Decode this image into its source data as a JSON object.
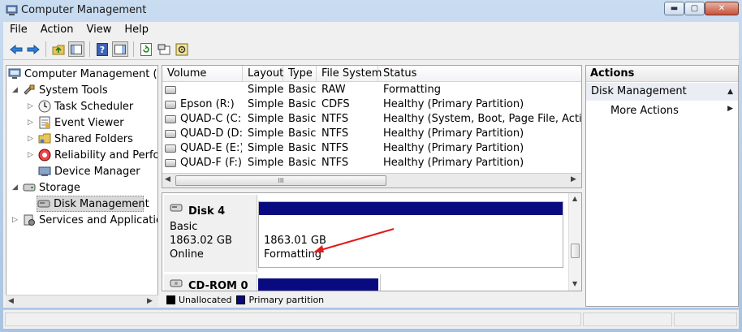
{
  "window": {
    "title": "Computer Management"
  },
  "menu": [
    "File",
    "Action",
    "View",
    "Help"
  ],
  "toolbar": {
    "icons": [
      "back-arrow-icon",
      "forward-arrow-icon",
      "up-folder-icon",
      "show-hide-tree-icon",
      "help-icon",
      "show-hide-action-pane-icon",
      "refresh-icon",
      "properties-icon",
      "settings-icon"
    ]
  },
  "tree": {
    "root": "Computer Management (Local)",
    "system_tools": "System Tools",
    "task_scheduler": "Task Scheduler",
    "event_viewer": "Event Viewer",
    "shared_folders": "Shared Folders",
    "reliability": "Reliability and Performance",
    "device_manager": "Device Manager",
    "storage": "Storage",
    "disk_management": "Disk Management",
    "services": "Services and Applications"
  },
  "volumes": {
    "columns": [
      "Volume",
      "Layout",
      "Type",
      "File System",
      "Status"
    ],
    "rows": [
      {
        "volume": "",
        "layout": "Simple",
        "type": "Basic",
        "fs": "RAW",
        "status": "Formatting"
      },
      {
        "volume": "Epson (R:)",
        "layout": "Simple",
        "type": "Basic",
        "fs": "CDFS",
        "status": "Healthy (Primary Partition)"
      },
      {
        "volume": "QUAD-C (C:)",
        "layout": "Simple",
        "type": "Basic",
        "fs": "NTFS",
        "status": "Healthy (System, Boot, Page File, Active, C"
      },
      {
        "volume": "QUAD-D (D:)",
        "layout": "Simple",
        "type": "Basic",
        "fs": "NTFS",
        "status": "Healthy (Primary Partition)"
      },
      {
        "volume": "QUAD-E (E:)",
        "layout": "Simple",
        "type": "Basic",
        "fs": "NTFS",
        "status": "Healthy (Primary Partition)"
      },
      {
        "volume": "QUAD-F (F:)",
        "layout": "Simple",
        "type": "Basic",
        "fs": "NTFS",
        "status": "Healthy (Primary Partition)"
      }
    ],
    "scroll_thumb": "III"
  },
  "disks": {
    "disk4": {
      "name": "Disk 4",
      "type": "Basic",
      "size": "1863.02 GB",
      "state": "Online",
      "part_size": "1863.01 GB",
      "part_status": "Formatting"
    },
    "cdrom": {
      "name": "CD-ROM 0"
    }
  },
  "legend": {
    "unallocated": "Unallocated",
    "primary": "Primary partition",
    "unallocated_color": "#000000",
    "primary_color": "#0a0a80"
  },
  "actions": {
    "header": "Actions",
    "section": "Disk Management",
    "more": "More Actions"
  },
  "colors": {
    "annotation_arrow": "#e21b1b"
  }
}
